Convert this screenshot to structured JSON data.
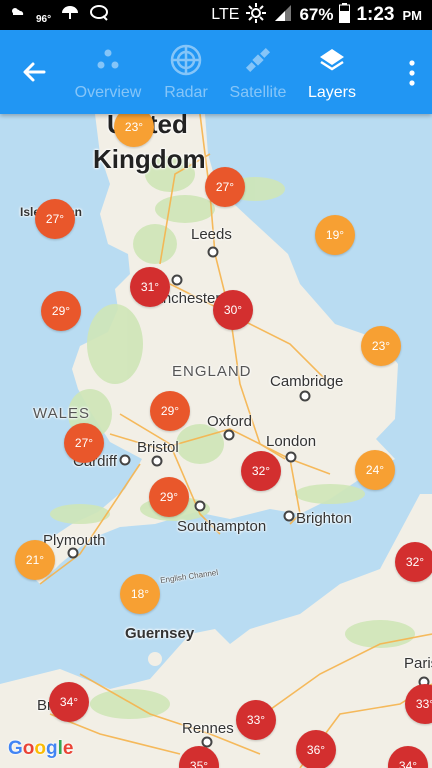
{
  "status_bar": {
    "temp": "96°",
    "network": "LTE",
    "battery": "67%",
    "time": "1:23",
    "ampm": "PM"
  },
  "app_bar": {
    "tabs": [
      {
        "label": "Overview",
        "icon": "dots-icon",
        "active": false
      },
      {
        "label": "Radar",
        "icon": "radar-icon",
        "active": false
      },
      {
        "label": "Satellite",
        "icon": "satellite-icon",
        "active": false
      },
      {
        "label": "Layers",
        "icon": "layers-icon",
        "active": true
      }
    ]
  },
  "map": {
    "places": {
      "uk_1": "United",
      "uk_2": "Kingdom",
      "isle": "Isle of Man",
      "leeds": "Leeds",
      "manchester": "Manchester",
      "england": "ENGLAND",
      "cambridge": "Cambridge",
      "wales": "WALES",
      "oxford": "Oxford",
      "bristol": "Bristol",
      "london": "London",
      "cardiff": "Cardiff",
      "southampton": "Southampton",
      "brighton": "Brighton",
      "plymouth": "Plymouth",
      "channel": "English Channel",
      "guernsey": "Guernsey",
      "rennes": "Rennes",
      "paris": "Paris",
      "brest": "Brest"
    },
    "temperatures": [
      "23°",
      "27°",
      "27°",
      "19°",
      "31°",
      "29°",
      "30°",
      "23°",
      "29°",
      "27°",
      "32°",
      "24°",
      "29°",
      "21°",
      "18°",
      "32°",
      "34°",
      "33°",
      "36°",
      "33°",
      "35°",
      "34°"
    ],
    "colors": {
      "hot": "#d32f2f",
      "warm": "#e9572b",
      "mild": "#f7a033",
      "sea": "#b9dcf2",
      "land": "#f2efe6"
    },
    "attribution": "Google"
  }
}
